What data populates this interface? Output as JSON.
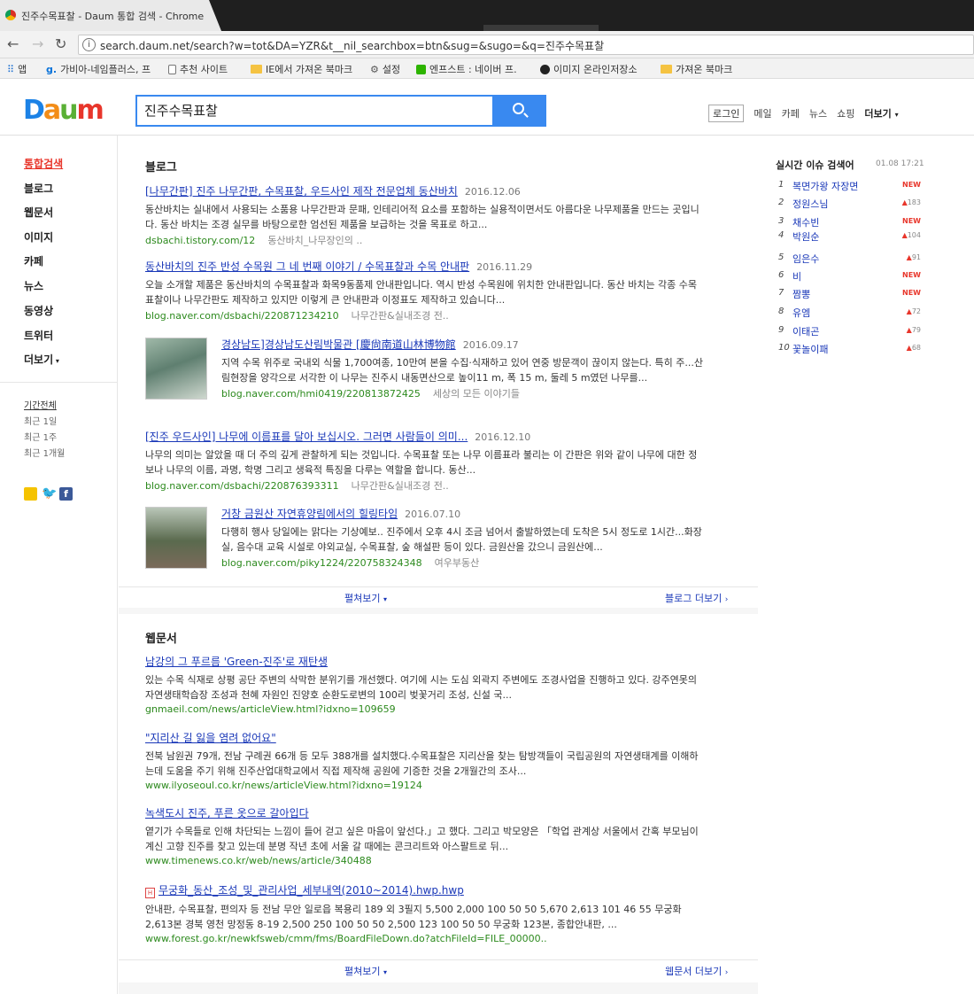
{
  "browser": {
    "tab_title": "진주수목표찰 - Daum 통합 검색 - Chrome",
    "url": "search.daum.net/search?w=tot&DA=YZR&t__nil_searchbox=btn&sug=&sugo=&q=진주수목표찰",
    "bookmarks": [
      "앱",
      "가비아-네임플러스, 프",
      "추천 사이트",
      "IE에서 가져온 북마크",
      "설정",
      "엔프스트 : 네이버 프.",
      "이미지 온라인저장소",
      "가져온 북마크"
    ]
  },
  "header": {
    "logo_text": "Daum",
    "search_query": "진주수목표찰",
    "links": {
      "login": "로그인",
      "mail": "메일",
      "cafe": "카페",
      "news": "뉴스",
      "shopping": "쇼핑",
      "more": "더보기"
    }
  },
  "sidebar": {
    "items": [
      "통합검색",
      "블로그",
      "웹문서",
      "이미지",
      "카페",
      "뉴스",
      "동영상",
      "트위터",
      "더보기"
    ],
    "periods": [
      "기간전체",
      "최근 1일",
      "최근 1주",
      "최근 1개월"
    ]
  },
  "blog": {
    "title": "블로그",
    "results": [
      {
        "title": "[나무간판] 진주 나무간판, 수목표찰, 우드사인 제작 전문업체 동산바치",
        "date": "2016.12.06",
        "desc": "동산바치는 실내에서 사용되는 소품용 나무간판과 문패, 인테리어적 요소를 포함하는 실용적이면서도 아름다운 나무제품을 만드는 곳입니다. 동산 바치는 조경 실무를 바탕으로한 엄선된 제품을 보급하는 것을 목표로 하고...",
        "url": "dsbachi.tistory.com/12",
        "source": "동산바치_나무장인의 .."
      },
      {
        "title": "동산바치의 진주 반성 수목원 그 네 번째 이야기 / 수목표찰과 수목 안내판",
        "date": "2016.11.29",
        "desc": "오늘 소개할 제품은 동산바치의 수목표찰과 화목9동품제 안내판입니다. 역시 반성 수목원에 위치한 안내판입니다. 동산 바치는 각종 수목표찰이나 나무간판도 제작하고 있지만 이렇게 큰 안내판과 이정표도 제작하고 있습니다...",
        "url": "blog.naver.com/dsbachi/220871234210",
        "source": "나무간판&실내조경 전.."
      },
      {
        "title": "경상남도]경상남도산림박물관 [慶尙南道山林博物館",
        "date": "2016.09.17",
        "desc": "지역 수목 위주로 국내외 식물 1,700여종, 10만여 본을 수집·식재하고 있어 연중 방문객이 끊이지 않는다. 특히 주...산림현장을 양각으로 서각한 이 나무는 진주시 내동면산으로 높이11 m, 폭 15 m, 둘레 5 m였던 나무를...",
        "url": "blog.naver.com/hmi0419/220813872425",
        "source": "세상의 모든 이야기들"
      },
      {
        "title": "[진주 우드사인] 나무에 이름표를 달아 보십시오. 그러면 사람들이 의미...",
        "date": "2016.12.10",
        "desc": "나무의 의미는 알았을 때 더 주의 깊게 관찰하게 되는 것입니다. 수목표찰 또는 나무 이름표라 불리는 이 간판은 위와 같이 나무에 대한 정보나 나무의 이름, 과명, 학명 그리고 생육적 특징을 다루는 역할을 합니다. 동산...",
        "url": "blog.naver.com/dsbachi/220876393311",
        "source": "나무간판&실내조경 전.."
      },
      {
        "title": "거창 금원산 자연휴양림에서의 힐링타임",
        "date": "2016.07.10",
        "desc": "다행히 행사 당일에는 맑다는 기상예보.. 진주에서 오후 4시 조금 넘어서 출발하였는데 도착은 5시 정도로 1시간...화장실, 음수대 교육 시설로 야외교실, 수목표찰, 숲 해설판 등이 있다. 금원산을 갔으니 금원산에...",
        "url": "blog.naver.com/piky1224/220758324348",
        "source": "여우부동산"
      }
    ],
    "expand": "펼쳐보기",
    "more": "블로그 더보기"
  },
  "web": {
    "title": "웹문서",
    "results": [
      {
        "title": "남강의 그 푸르름 'Green-진주'로 재탄생",
        "desc": "있는 수목 식재로 상평 공단 주변의 삭막한 분위기를 개선했다. 여기에 시는 도심 외곽지 주변에도 조경사업을 진행하고 있다. 강주연못의 자연생태학습장 조성과 천혜 자원인 진양호 순환도로변의 100리 벚꽃거리 조성, 신설 국...",
        "url": "gnmaeil.com/news/articleView.html?idxno=109659"
      },
      {
        "title": "\"지리산 길 잃을 염려 없어요\"",
        "desc": "전북 남원권 79개, 전남 구례권 66개 등 모두 388개를 설치했다.수목표찰은 지리산을 찾는 탐방객들이 국립공원의 자연생태계를 이해하는데 도움을 주기 위해 진주산업대학교에서 직접 제작해 공원에 기증한 것을 2개월간의 조사...",
        "url": "www.ilyoseoul.co.kr/news/articleView.html?idxno=19124"
      },
      {
        "title": "녹색도시 진주, 푸른 옷으로 갈아입다",
        "desc": "옅기가 수목들로 인해 차단되는 느낌이 들어 걷고 싶은 마음이 앞선다.」고 했다. 그리고 박모양은 「학업 관계상 서울에서 간혹 부모님이 계신 고향 진주를 찾고 있는데 분명 작년 초에 서울 갈 때에는 콘크리트와 아스팔트로 뒤...",
        "url": "www.timenews.co.kr/web/news/article/340488"
      },
      {
        "title": "무궁화_동산_조성_및_관리사업_세부내역(2010~2014).hwp.hwp",
        "desc": "안내판, 수목표찰, 편의자 등 전남 무안 일로읍 복용리 189 외 3필지 5,500 2,000 100 50 50 5,670 2,613 101 46 55 무궁화 2,613본 경북 영천 망정동 8-19 2,500 250 100 50 50 2,500 123 100 50 50 무궁화 123본, 종합안내판, ...",
        "url": "www.forest.go.kr/newkfsweb/cmm/fms/BoardFileDown.do?atchFileId=FILE_00000.."
      }
    ],
    "expand": "펼쳐보기",
    "more": "웹문서 더보기"
  },
  "realtime": {
    "title": "실시간 이슈 검색어",
    "time": "01.08 17:21",
    "items": [
      {
        "rank": "1",
        "term": "복면가왕 자장면",
        "change": "NEW"
      },
      {
        "rank": "2",
        "term": "정원스님",
        "change": "183"
      },
      {
        "rank": "3",
        "term": "채수빈",
        "change": "NEW"
      },
      {
        "rank": "4",
        "term": "박원순",
        "change": "104"
      },
      {
        "rank": "5",
        "term": "임은수",
        "change": "91"
      },
      {
        "rank": "6",
        "term": "비",
        "change": "NEW"
      },
      {
        "rank": "7",
        "term": "짬뽕",
        "change": "NEW"
      },
      {
        "rank": "8",
        "term": "유엠",
        "change": "72"
      },
      {
        "rank": "9",
        "term": "이태곤",
        "change": "79"
      },
      {
        "rank": "10",
        "term": "꽃놀이패",
        "change": "68"
      }
    ]
  }
}
